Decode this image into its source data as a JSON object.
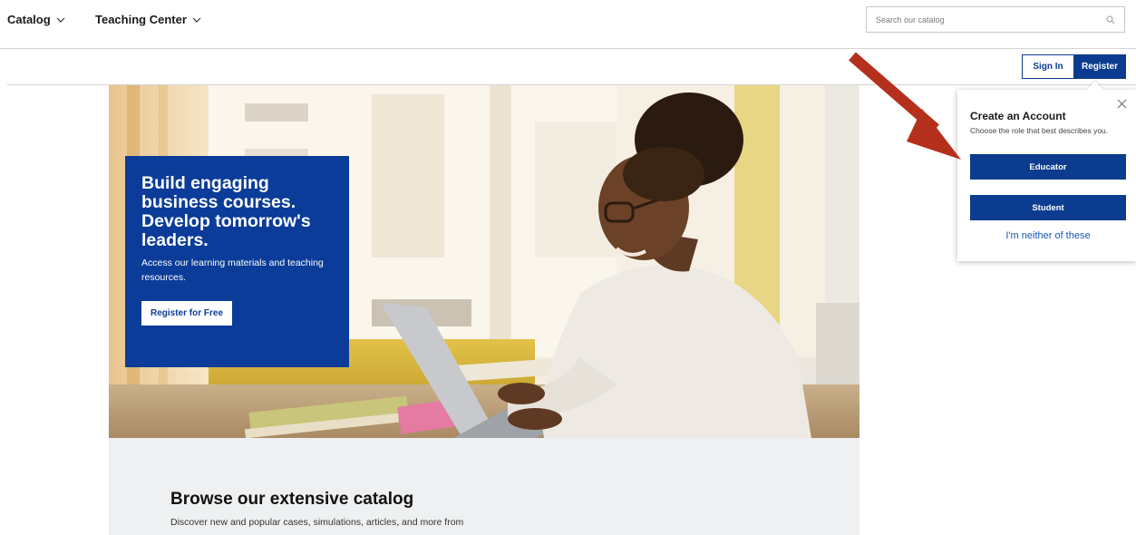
{
  "nav": {
    "catalog": "Catalog",
    "teaching_center": "Teaching Center",
    "search_placeholder": "Search our catalog"
  },
  "account": {
    "sign_in": "Sign In",
    "register": "Register"
  },
  "hero": {
    "headline": "Build engaging business courses. Develop tomorrow's leaders.",
    "body": "Access our learning materials and teaching resources.",
    "cta": "Register for Free"
  },
  "browse": {
    "title": "Browse our extensive catalog",
    "body": "Discover new and popular cases, simulations, articles, and more from"
  },
  "popover": {
    "title": "Create an Account",
    "subtitle": "Choose the role that best describes you.",
    "educator": "Educator",
    "student": "Student",
    "neither": "I'm neither of these"
  },
  "colors": {
    "brand_blue": "#0b3c8f",
    "promo_blue": "#0b3c99",
    "link_blue": "#1656b7",
    "annotation_arrow": "#b5301c"
  },
  "icons": [
    "chevron-down-icon",
    "search-icon",
    "close-icon",
    "annotation-arrow"
  ]
}
